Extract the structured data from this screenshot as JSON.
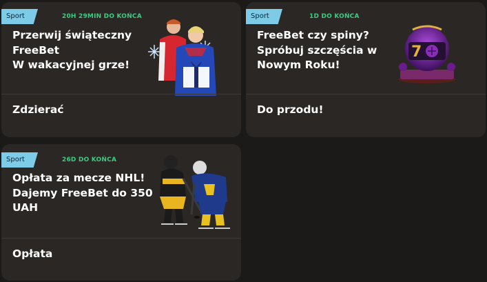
{
  "promos": [
    {
      "tag": "Sport",
      "timer": "20H 29MIN DO KOŃCA",
      "title_lines": [
        "Przerwij świąteczny",
        "FreeBet",
        "W wakacyjnej grze!"
      ],
      "cta": "Zdzierać",
      "image": "football-players-gift-icon"
    },
    {
      "tag": "Sport",
      "timer": "1D DO KOŃCA",
      "title_lines": [
        "FreeBet czy spiny?",
        "Spróbuj szczęścia w",
        "Nowym Roku!"
      ],
      "cta": "Do przodu!",
      "image": "purple-slot-machine-icon"
    },
    {
      "tag": "Sport",
      "timer": "26D DO KOŃCA",
      "title_lines": [
        "Opłata za mecze NHL!",
        "Dajemy FreeBet do 350",
        "UAH"
      ],
      "cta": "Opłata",
      "image": "hockey-players-icon"
    }
  ],
  "colors": {
    "background": "#1c1a18",
    "card": "#2a2724",
    "tag": "#7ecbe8",
    "timer": "#3ecb83"
  }
}
